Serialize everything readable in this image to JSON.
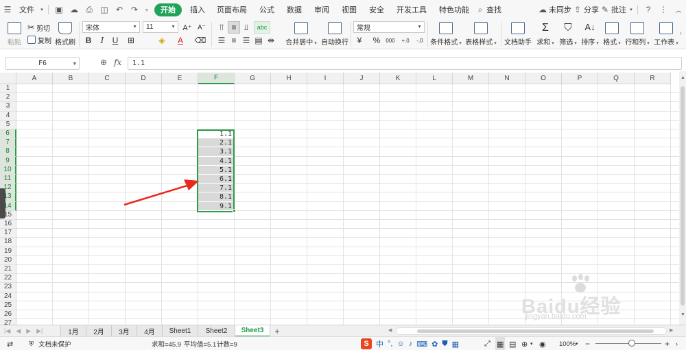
{
  "menubar": {
    "file": "文件",
    "tabs": [
      "开始",
      "插入",
      "页面布局",
      "公式",
      "数据",
      "审阅",
      "视图",
      "安全",
      "开发工具",
      "特色功能"
    ],
    "search": "查找",
    "sync": "未同步",
    "share": "分享",
    "comment": "批注"
  },
  "ribbon": {
    "paste": "粘贴",
    "cut": "剪切",
    "copy": "复制",
    "format_painter": "格式刷",
    "font": "宋体",
    "font_size": "11",
    "merge_center": "合并居中",
    "wrap_text": "自动换行",
    "number_format": "常规",
    "conditional_format": "条件格式",
    "table_style": "表格样式",
    "doc_helper": "文档助手",
    "sum": "求和",
    "filter": "筛选",
    "sort": "排序",
    "format": "格式",
    "row_col": "行和列",
    "worksheet": "工作表"
  },
  "formula_bar": {
    "name_box": "F6",
    "fx": "fx",
    "value": "1.1"
  },
  "grid": {
    "columns": [
      "A",
      "B",
      "C",
      "D",
      "E",
      "F",
      "G",
      "H",
      "I",
      "J",
      "K",
      "L",
      "M",
      "N",
      "O",
      "P",
      "Q",
      "R"
    ],
    "rows": [
      "1",
      "2",
      "3",
      "4",
      "5",
      "6",
      "7",
      "8",
      "9",
      "10",
      "11",
      "12",
      "13",
      "14",
      "15",
      "16",
      "17",
      "18",
      "19",
      "20",
      "21",
      "22",
      "23",
      "24",
      "25",
      "26",
      "27"
    ],
    "selected_column": "F",
    "data_cells": [
      "1.1",
      "2.1",
      "3.1",
      "4.1",
      "5.1",
      "6.1",
      "7.1",
      "8.1",
      "9.1"
    ]
  },
  "sheets": {
    "tabs": [
      "1月",
      "2月",
      "3月",
      "4月",
      "Sheet1",
      "Sheet2",
      "Sheet3"
    ],
    "active": "Sheet3",
    "add": "+"
  },
  "status": {
    "protect": "文档未保护",
    "sum": "求和=45.9",
    "average": "平均值=5.1",
    "count": "计数=9",
    "zoom": "100%",
    "ime_lang": "中"
  },
  "watermark": {
    "brand": "Baidu经验",
    "url": "jingyan.baidu.com"
  },
  "colors": {
    "accent": "#22a35a",
    "selection": "#2a9d48",
    "arrow": "#e8291c",
    "cell_fill": "#d9d9d9"
  }
}
